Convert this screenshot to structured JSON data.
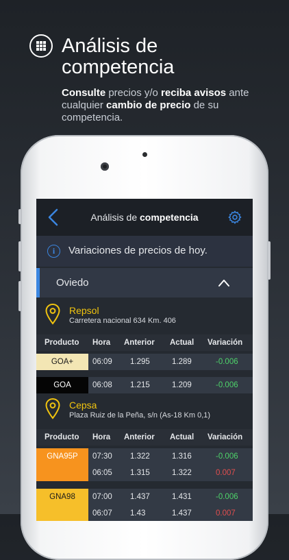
{
  "header": {
    "title": "Análisis de competencia",
    "subtitle_parts": [
      {
        "text": "Consulte",
        "bold": true
      },
      {
        "text": " precios y/o ",
        "bold": false
      },
      {
        "text": "reciba avisos",
        "bold": true
      },
      {
        "text": " ante cualquier ",
        "bold": false
      },
      {
        "text": "cambio de precio",
        "bold": true
      },
      {
        "text": " de su competencia.",
        "bold": false
      }
    ]
  },
  "nav": {
    "back_icon": "chevron-left-icon",
    "title_regular": "Análisis de ",
    "title_bold": "competencia",
    "settings_icon": "gear-icon",
    "accent": "#3b86e0"
  },
  "info": {
    "text": "Variaciones de precios de hoy."
  },
  "city": {
    "label": "Oviedo"
  },
  "table_headers": [
    "Producto",
    "Hora",
    "Anterior",
    "Actual",
    "Variación"
  ],
  "stations": [
    {
      "name": "Repsol",
      "address": "Carretera nacional 634 Km. 406",
      "rows": [
        {
          "product": "GOA+",
          "badge_color": "#f3e6b4",
          "badge_text_color": "#1a1a1a",
          "hora": "06:09",
          "anterior": "1.295",
          "actual": "1.289",
          "variacion": "-0.006",
          "sign": "pos"
        },
        {
          "product": "GOA",
          "badge_color": "#050505",
          "badge_text_color": "#ffffff",
          "hora": "06:08",
          "anterior": "1.215",
          "actual": "1.209",
          "variacion": "-0.006",
          "sign": "pos"
        }
      ]
    },
    {
      "name": "Cepsa",
      "address": "Plaza Ruiz de la Peña, s/n (As-18 Km 0,1)",
      "rows": [
        {
          "product": "GNA95P",
          "badge_color": "#f7931e",
          "badge_text_color": "#ffffff",
          "hora": "07:30",
          "anterior": "1.322",
          "actual": "1.316",
          "variacion": "-0.006",
          "sign": "pos"
        },
        {
          "product": "",
          "badge_color": "#f7931e",
          "badge_text_color": "#ffffff",
          "hora": "06:05",
          "anterior": "1.315",
          "actual": "1.322",
          "variacion": "0.007",
          "sign": "neg"
        },
        {
          "product": "GNA98",
          "badge_color": "#f6bf2a",
          "badge_text_color": "#1a1a1a",
          "hora": "07:00",
          "anterior": "1.437",
          "actual": "1.431",
          "variacion": "-0.006",
          "sign": "pos"
        },
        {
          "product": "",
          "badge_color": "#f6bf2a",
          "badge_text_color": "#1a1a1a",
          "hora": "06:07",
          "anterior": "1.43",
          "actual": "1.437",
          "variacion": "0.007",
          "sign": "neg"
        }
      ]
    }
  ]
}
